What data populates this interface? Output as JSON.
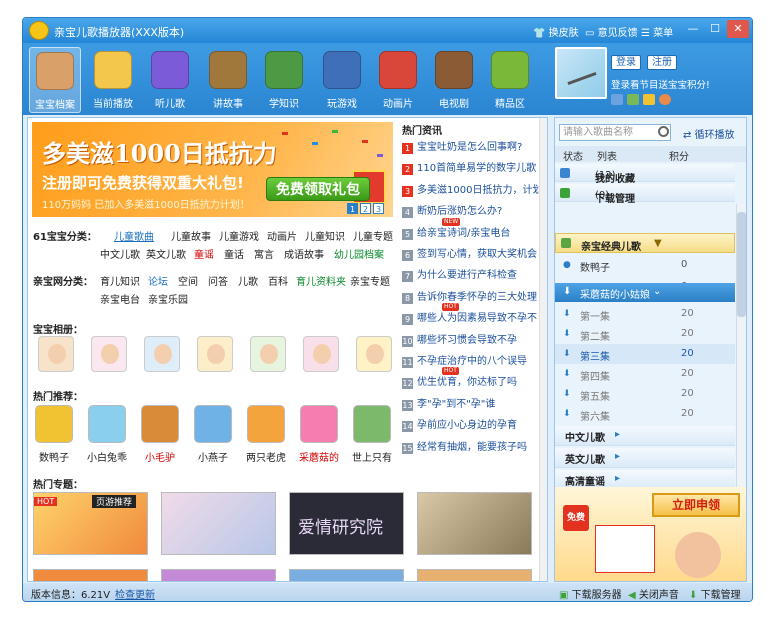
{
  "window": {
    "title": "亲宝儿歌播放器",
    "edition": "(XXX版本)",
    "links": [
      "换皮肤",
      "意见反馈",
      "菜单"
    ],
    "controls": [
      "—",
      "☐",
      "✕"
    ]
  },
  "nav": [
    {
      "label": "宝宝档案",
      "icon": "baby-profile-icon",
      "color": "#d9a06a"
    },
    {
      "label": "当前播放",
      "icon": "now-playing-icon",
      "color": "#f3c64c"
    },
    {
      "label": "听儿歌",
      "icon": "music-icon",
      "color": "#7c5bd9"
    },
    {
      "label": "讲故事",
      "icon": "story-book-icon",
      "color": "#a0783c"
    },
    {
      "label": "学知识",
      "icon": "knowledge-book-icon",
      "color": "#4c9a44"
    },
    {
      "label": "玩游戏",
      "icon": "joystick-icon",
      "color": "#3f6fb9"
    },
    {
      "label": "动画片",
      "icon": "cartoon-icon",
      "color": "#d9463a"
    },
    {
      "label": "电视剧",
      "icon": "tv-icon",
      "color": "#8a5b34"
    },
    {
      "label": "精品区",
      "icon": "star-icon",
      "color": "#7ab83a"
    }
  ],
  "user": {
    "login": "登录",
    "register": "注册",
    "hint": "登录看节目送宝宝积分!"
  },
  "banner": {
    "title": "多美滋1000日抵抗力",
    "subtitle": "注册即可免费获得双重大礼包!",
    "note": "110万妈妈 已加入多美滋1000日抵抗力计划！",
    "button": "免费领取礼包",
    "pages": [
      "1",
      "2",
      "3"
    ]
  },
  "categories": {
    "head": "61宝宝分类：",
    "row1": [
      "儿童歌曲",
      "儿童故事",
      "儿童游戏",
      "动画片",
      "儿童知识",
      "儿童专题"
    ],
    "row2": [
      "中文儿歌",
      "英文儿歌",
      "童谣",
      "童话",
      "寓言",
      "成语故事",
      "幼儿园档案"
    ]
  },
  "net": {
    "head": "亲宝网分类：",
    "row1": [
      "育儿知识",
      "论坛",
      "空间",
      "问答",
      "儿歌",
      "百科",
      "育儿资料夹",
      "亲宝专题"
    ],
    "row2": [
      "亲宝电台",
      "亲宝乐园"
    ]
  },
  "album_title": "宝宝相册：",
  "recommend_title": "热门推荐：",
  "recommend": [
    {
      "name": "数鸭子",
      "color": "#f1c232"
    },
    {
      "name": "小白兔乖",
      "color": "#8ad0ee"
    },
    {
      "name": "小毛驴",
      "color": "#d98b3a"
    },
    {
      "name": "小燕子",
      "color": "#6fb2e6"
    },
    {
      "name": "两只老虎",
      "color": "#f3a43c"
    },
    {
      "name": "采蘑菇的",
      "color": "#f57db0"
    },
    {
      "name": "世上只有",
      "color": "#7cb96a"
    }
  ],
  "topics_title": "热门专题：",
  "topics": [
    {
      "text": "页游推荐",
      "tag": "HOT"
    },
    {
      "text": ""
    },
    {
      "text": "爱情研究院"
    },
    {
      "text": ""
    }
  ],
  "news": {
    "title": "热门资讯",
    "items": [
      {
        "num": "1",
        "text": "宝宝吐奶是怎么回事啊?",
        "hot": true
      },
      {
        "num": "2",
        "text": "110首简单易学的数字儿歌",
        "hot": true
      },
      {
        "num": "3",
        "text": "多美滋1000日抵抗力，计划",
        "hot": true
      },
      {
        "num": "4",
        "text": "断奶后涨奶怎么办?"
      },
      {
        "num": "5",
        "text": "给亲宝诗词/亲宝电台",
        "tag": "NEW"
      },
      {
        "num": "6",
        "text": "签到写心情，获取大奖机会"
      },
      {
        "num": "7",
        "text": "为什么要进行产科检查"
      },
      {
        "num": "8",
        "text": "告诉你春季怀孕的三大处理"
      },
      {
        "num": "9",
        "text": "哪些人为因素易导致不孕不",
        "tag": "HOT"
      },
      {
        "num": "10",
        "text": "哪些坏习惯会导致不孕"
      },
      {
        "num": "11",
        "text": "不孕症治疗中的八个误导"
      },
      {
        "num": "12",
        "text": "优生优育，你达标了吗",
        "tag": "HOT"
      },
      {
        "num": "13",
        "text": "李\"孕\"到不\"孕\"谁"
      },
      {
        "num": "14",
        "text": "孕前应小心身边的孕育"
      },
      {
        "num": "15",
        "text": "经常有抽烟，能要孩子吗"
      }
    ]
  },
  "search": {
    "placeholder": "请输入歌曲名称",
    "loop": "循环播放"
  },
  "playlist": {
    "headers": [
      "状态",
      "列表",
      "积分"
    ],
    "fav": "我的收藏",
    "fav_count": "(12)",
    "dl": "下载管理",
    "dl_count": "(0)",
    "album": "亲宝经典儿歌",
    "songs": [
      {
        "name": "数鸭子",
        "score": "0"
      },
      {
        "name": "长颈鹿",
        "score": "0"
      }
    ],
    "sub": "采蘑菇的小姑娘",
    "episodes": [
      {
        "name": "第一集",
        "score": "20"
      },
      {
        "name": "第二集",
        "score": "20"
      },
      {
        "name": "第三集",
        "score": "20"
      },
      {
        "name": "第四集",
        "score": "20"
      },
      {
        "name": "第五集",
        "score": "20"
      },
      {
        "name": "第六集",
        "score": "20"
      }
    ],
    "groups": [
      "中文儿歌",
      "英文儿歌",
      "高清童谣"
    ]
  },
  "ad": {
    "free": "免费",
    "button": "立即申领"
  },
  "status": {
    "version": "版本信息：6.21V",
    "update": "检查更新",
    "download": "下载服务器",
    "sound": "关闭声音",
    "manage": "下载管理"
  }
}
